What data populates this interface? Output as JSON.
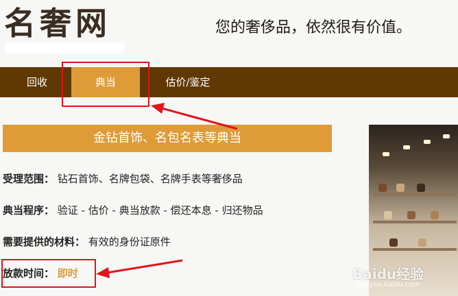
{
  "header": {
    "logo_text": "名奢网",
    "slogan": "您的奢侈品，依然很有价值。"
  },
  "nav": {
    "items": [
      {
        "label": "回收"
      },
      {
        "label": "典当"
      },
      {
        "label": "估价/鉴定"
      }
    ],
    "active_index": 1
  },
  "main": {
    "banner": "金钻首饰、名包名表等典当",
    "scope_label": "受理范围：",
    "scope_value": "钻石首饰、名牌包袋、名牌手表等奢侈品",
    "process_label": "典当程序：",
    "process_value": "验证 - 估价 - 典当放款 - 偿还本息 - 归还物品",
    "materials_label": "需要提供的材料：",
    "materials_value": "有效的身份证原件",
    "loan_time_label": "放款时间：",
    "loan_time_value": "即时"
  },
  "watermark": {
    "text": "Baidu经验",
    "url": "jingyan.baidu.com"
  },
  "colors": {
    "nav_bg": "#603804",
    "accent": "#de9b37",
    "annotation": "#e0141a"
  }
}
